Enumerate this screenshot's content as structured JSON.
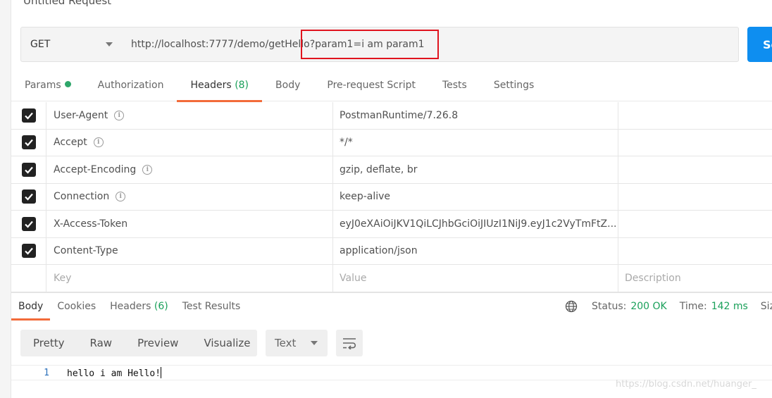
{
  "request": {
    "title": "Untitled Request",
    "method": "GET",
    "url": "http://localhost:7777/demo/getHello?param1=i am param1",
    "send_label": "Se"
  },
  "request_tabs": [
    {
      "label": "Params",
      "count": "",
      "dot": true
    },
    {
      "label": "Authorization",
      "count": ""
    },
    {
      "label": "Headers",
      "count": "(8)"
    },
    {
      "label": "Body",
      "count": ""
    },
    {
      "label": "Pre-request Script",
      "count": ""
    },
    {
      "label": "Tests",
      "count": ""
    },
    {
      "label": "Settings",
      "count": ""
    }
  ],
  "headers": [
    {
      "key": "User-Agent",
      "value": "PostmanRuntime/7.26.8",
      "info": true,
      "checked": true
    },
    {
      "key": "Accept",
      "value": "*/*",
      "info": true,
      "checked": true
    },
    {
      "key": "Accept-Encoding",
      "value": "gzip, deflate, br",
      "info": true,
      "checked": true
    },
    {
      "key": "Connection",
      "value": "keep-alive",
      "info": true,
      "checked": true
    },
    {
      "key": "X-Access-Token",
      "value": "eyJ0eXAiOiJKV1QiLCJhbGciOiJIUzI1NiJ9.eyJ1c2VyTmFtZ...",
      "info": false,
      "checked": true
    },
    {
      "key": "Content-Type",
      "value": "application/json",
      "info": false,
      "checked": true
    }
  ],
  "new_row": {
    "key_placeholder": "Key",
    "value_placeholder": "Value",
    "description_placeholder": "Description"
  },
  "response_tabs": [
    {
      "label": "Body",
      "count": ""
    },
    {
      "label": "Cookies",
      "count": ""
    },
    {
      "label": "Headers",
      "count": "(6)"
    },
    {
      "label": "Test Results",
      "count": ""
    }
  ],
  "status": {
    "status_label": "Status:",
    "status_value": "200 OK",
    "time_label": "Time:",
    "time_value": "142 ms",
    "size_label": "Size:"
  },
  "format_buttons": [
    "Pretty",
    "Raw",
    "Preview",
    "Visualize"
  ],
  "language": "Text",
  "body": {
    "line_number": "1",
    "text": "hello i am Hello!"
  },
  "watermark": "https://blog.csdn.net/huanger_",
  "colors": {
    "accent": "#f26b3a",
    "send": "#0e8ef0",
    "success": "#1aa05a",
    "highlight": "#e0141e"
  }
}
